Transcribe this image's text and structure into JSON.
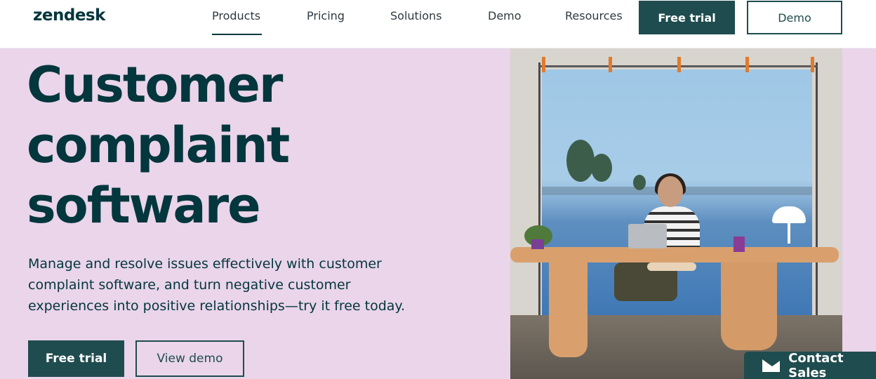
{
  "header": {
    "logo": "zendesk",
    "nav": [
      "Products",
      "Pricing",
      "Solutions",
      "Demo",
      "Resources"
    ],
    "active_nav": "Products",
    "free_trial": "Free trial",
    "demo": "Demo"
  },
  "hero": {
    "title_lines": [
      "Customer",
      "complaint",
      "software"
    ],
    "description_lines": [
      "Manage and resolve issues effectively with customer",
      "complaint software, and turn negative customer",
      "experiences into positive relationships—try it free today."
    ],
    "primary_button": "Free trial",
    "secondary_button": "View demo"
  },
  "contact_sales": {
    "label": "Contact Sales",
    "icon": "mail-icon"
  },
  "colors": {
    "brand": "#1f4c4f",
    "hero_bg": "#ead5ea",
    "text": "#03363d"
  }
}
